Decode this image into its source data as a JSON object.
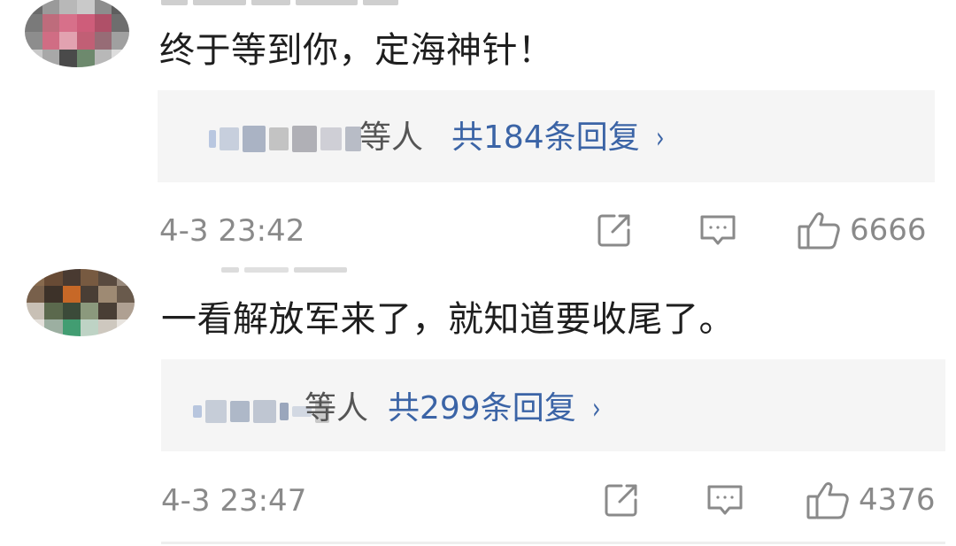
{
  "comments": [
    {
      "avatar_icon": "blurred-avatar",
      "text": "终于等到你，定海神针！",
      "replies": {
        "suffix": "等人",
        "count_label": "共184条回复",
        "chevron": "›"
      },
      "timestamp": "4-3 23:42",
      "likes": "6666"
    },
    {
      "avatar_icon": "blurred-avatar",
      "text": "一看解放军来了，就知道要收尾了。",
      "replies": {
        "suffix": "等人",
        "count_label": "共299条回复",
        "chevron": "›"
      },
      "timestamp": "4-3 23:47",
      "likes": "4376"
    }
  ],
  "icons": {
    "share": "share-icon",
    "comment": "comment-icon",
    "like": "thumbs-up-icon"
  },
  "colors": {
    "reply_link": "#3b64a6",
    "reply_box_bg": "#f5f5f5",
    "meta_text": "#8a8a8a"
  }
}
